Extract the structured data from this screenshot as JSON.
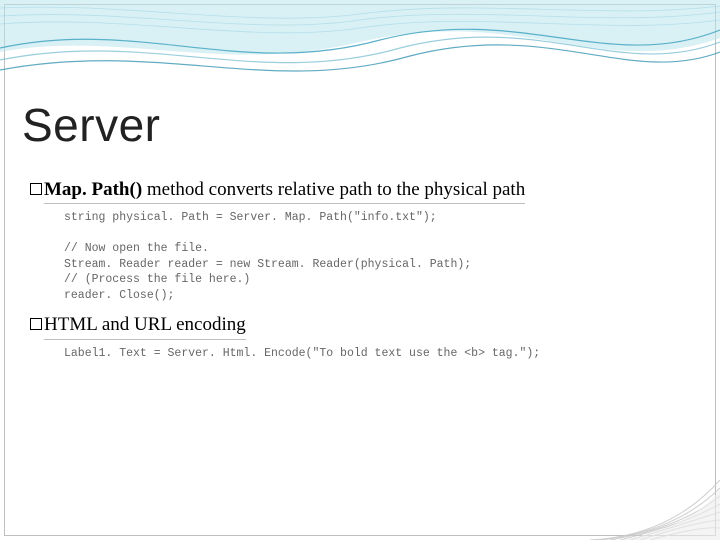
{
  "title": "Server",
  "bullets": [
    {
      "bold": "Map. Path()",
      "rest": "  method converts relative path to the physical path",
      "underline": true
    },
    {
      "bold": "",
      "rest": "HTML and URL encoding",
      "underline": true
    }
  ],
  "code1_l1": "string physical. Path = Server. Map. Path(\"info.txt\");",
  "code1_l2": "",
  "code1_l3": "// Now open the file.",
  "code1_l4": "Stream. Reader reader = new Stream. Reader(physical. Path);",
  "code1_l5": "// (Process the file here.)",
  "code1_l6": "reader. Close();",
  "code2_l1": "Label1. Text = Server. Html. Encode(\"To bold text use the <b> tag.\");"
}
